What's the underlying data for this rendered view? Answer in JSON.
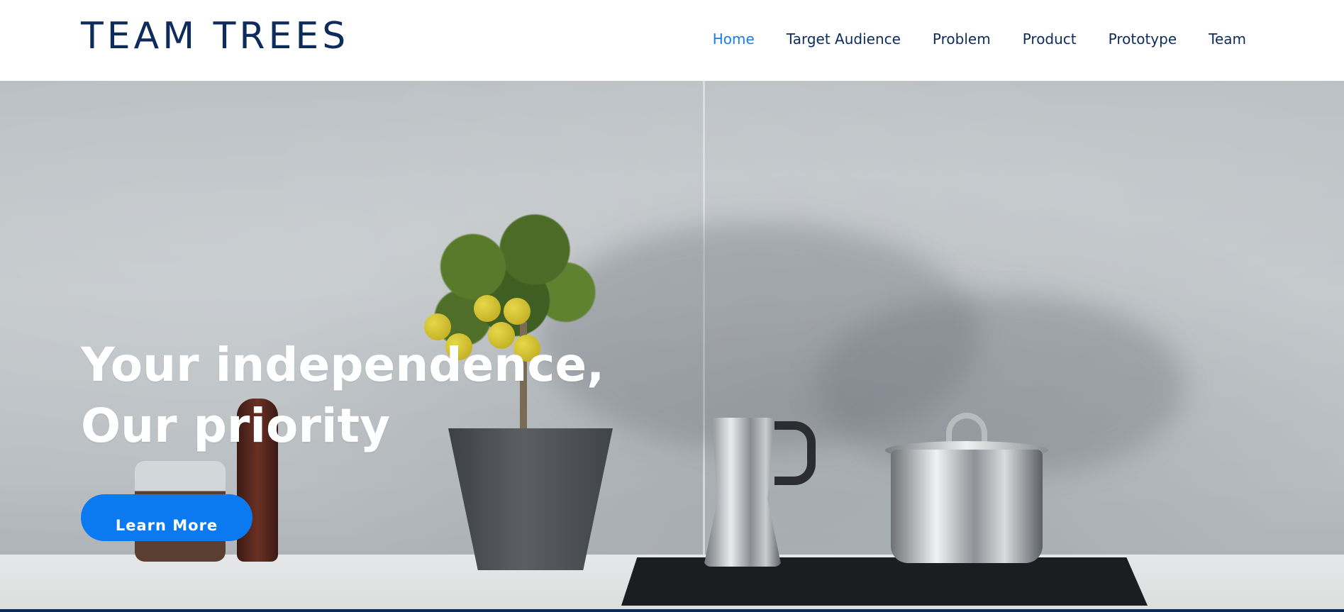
{
  "header": {
    "logo": "TEAM TREES",
    "nav": [
      {
        "label": "Home",
        "active": true
      },
      {
        "label": "Target Audience",
        "active": false
      },
      {
        "label": "Problem",
        "active": false
      },
      {
        "label": "Product",
        "active": false
      },
      {
        "label": "Prototype",
        "active": false
      },
      {
        "label": "Team",
        "active": false
      }
    ]
  },
  "hero": {
    "title_line1": "Your independence,",
    "title_line2": "Our priority",
    "cta_label": "Learn More"
  },
  "colors": {
    "brand_navy": "#0d2c5c",
    "accent_blue": "#1a7ee6",
    "cta_blue": "#0b7af0"
  }
}
